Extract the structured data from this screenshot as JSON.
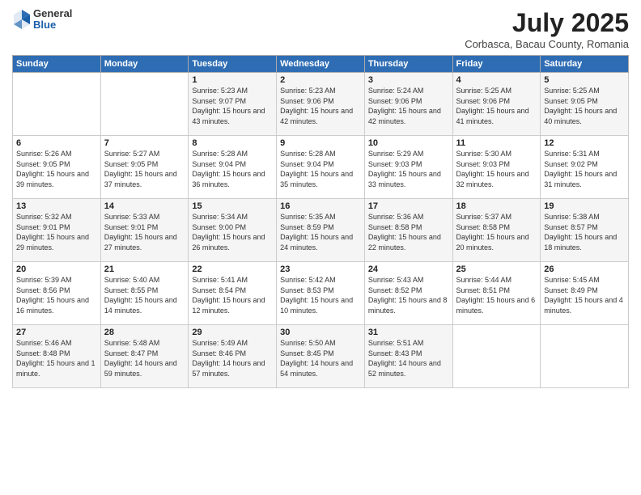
{
  "header": {
    "logo": {
      "line1": "General",
      "line2": "Blue"
    },
    "title": "July 2025",
    "location": "Corbasca, Bacau County, Romania"
  },
  "weekdays": [
    "Sunday",
    "Monday",
    "Tuesday",
    "Wednesday",
    "Thursday",
    "Friday",
    "Saturday"
  ],
  "weeks": [
    [
      {
        "day": "",
        "content": ""
      },
      {
        "day": "",
        "content": ""
      },
      {
        "day": "1",
        "content": "Sunrise: 5:23 AM\nSunset: 9:07 PM\nDaylight: 15 hours\nand 43 minutes."
      },
      {
        "day": "2",
        "content": "Sunrise: 5:23 AM\nSunset: 9:06 PM\nDaylight: 15 hours\nand 42 minutes."
      },
      {
        "day": "3",
        "content": "Sunrise: 5:24 AM\nSunset: 9:06 PM\nDaylight: 15 hours\nand 42 minutes."
      },
      {
        "day": "4",
        "content": "Sunrise: 5:25 AM\nSunset: 9:06 PM\nDaylight: 15 hours\nand 41 minutes."
      },
      {
        "day": "5",
        "content": "Sunrise: 5:25 AM\nSunset: 9:05 PM\nDaylight: 15 hours\nand 40 minutes."
      }
    ],
    [
      {
        "day": "6",
        "content": "Sunrise: 5:26 AM\nSunset: 9:05 PM\nDaylight: 15 hours\nand 39 minutes."
      },
      {
        "day": "7",
        "content": "Sunrise: 5:27 AM\nSunset: 9:05 PM\nDaylight: 15 hours\nand 37 minutes."
      },
      {
        "day": "8",
        "content": "Sunrise: 5:28 AM\nSunset: 9:04 PM\nDaylight: 15 hours\nand 36 minutes."
      },
      {
        "day": "9",
        "content": "Sunrise: 5:28 AM\nSunset: 9:04 PM\nDaylight: 15 hours\nand 35 minutes."
      },
      {
        "day": "10",
        "content": "Sunrise: 5:29 AM\nSunset: 9:03 PM\nDaylight: 15 hours\nand 33 minutes."
      },
      {
        "day": "11",
        "content": "Sunrise: 5:30 AM\nSunset: 9:03 PM\nDaylight: 15 hours\nand 32 minutes."
      },
      {
        "day": "12",
        "content": "Sunrise: 5:31 AM\nSunset: 9:02 PM\nDaylight: 15 hours\nand 31 minutes."
      }
    ],
    [
      {
        "day": "13",
        "content": "Sunrise: 5:32 AM\nSunset: 9:01 PM\nDaylight: 15 hours\nand 29 minutes."
      },
      {
        "day": "14",
        "content": "Sunrise: 5:33 AM\nSunset: 9:01 PM\nDaylight: 15 hours\nand 27 minutes."
      },
      {
        "day": "15",
        "content": "Sunrise: 5:34 AM\nSunset: 9:00 PM\nDaylight: 15 hours\nand 26 minutes."
      },
      {
        "day": "16",
        "content": "Sunrise: 5:35 AM\nSunset: 8:59 PM\nDaylight: 15 hours\nand 24 minutes."
      },
      {
        "day": "17",
        "content": "Sunrise: 5:36 AM\nSunset: 8:58 PM\nDaylight: 15 hours\nand 22 minutes."
      },
      {
        "day": "18",
        "content": "Sunrise: 5:37 AM\nSunset: 8:58 PM\nDaylight: 15 hours\nand 20 minutes."
      },
      {
        "day": "19",
        "content": "Sunrise: 5:38 AM\nSunset: 8:57 PM\nDaylight: 15 hours\nand 18 minutes."
      }
    ],
    [
      {
        "day": "20",
        "content": "Sunrise: 5:39 AM\nSunset: 8:56 PM\nDaylight: 15 hours\nand 16 minutes."
      },
      {
        "day": "21",
        "content": "Sunrise: 5:40 AM\nSunset: 8:55 PM\nDaylight: 15 hours\nand 14 minutes."
      },
      {
        "day": "22",
        "content": "Sunrise: 5:41 AM\nSunset: 8:54 PM\nDaylight: 15 hours\nand 12 minutes."
      },
      {
        "day": "23",
        "content": "Sunrise: 5:42 AM\nSunset: 8:53 PM\nDaylight: 15 hours\nand 10 minutes."
      },
      {
        "day": "24",
        "content": "Sunrise: 5:43 AM\nSunset: 8:52 PM\nDaylight: 15 hours\nand 8 minutes."
      },
      {
        "day": "25",
        "content": "Sunrise: 5:44 AM\nSunset: 8:51 PM\nDaylight: 15 hours\nand 6 minutes."
      },
      {
        "day": "26",
        "content": "Sunrise: 5:45 AM\nSunset: 8:49 PM\nDaylight: 15 hours\nand 4 minutes."
      }
    ],
    [
      {
        "day": "27",
        "content": "Sunrise: 5:46 AM\nSunset: 8:48 PM\nDaylight: 15 hours\nand 1 minute."
      },
      {
        "day": "28",
        "content": "Sunrise: 5:48 AM\nSunset: 8:47 PM\nDaylight: 14 hours\nand 59 minutes."
      },
      {
        "day": "29",
        "content": "Sunrise: 5:49 AM\nSunset: 8:46 PM\nDaylight: 14 hours\nand 57 minutes."
      },
      {
        "day": "30",
        "content": "Sunrise: 5:50 AM\nSunset: 8:45 PM\nDaylight: 14 hours\nand 54 minutes."
      },
      {
        "day": "31",
        "content": "Sunrise: 5:51 AM\nSunset: 8:43 PM\nDaylight: 14 hours\nand 52 minutes."
      },
      {
        "day": "",
        "content": ""
      },
      {
        "day": "",
        "content": ""
      }
    ]
  ]
}
